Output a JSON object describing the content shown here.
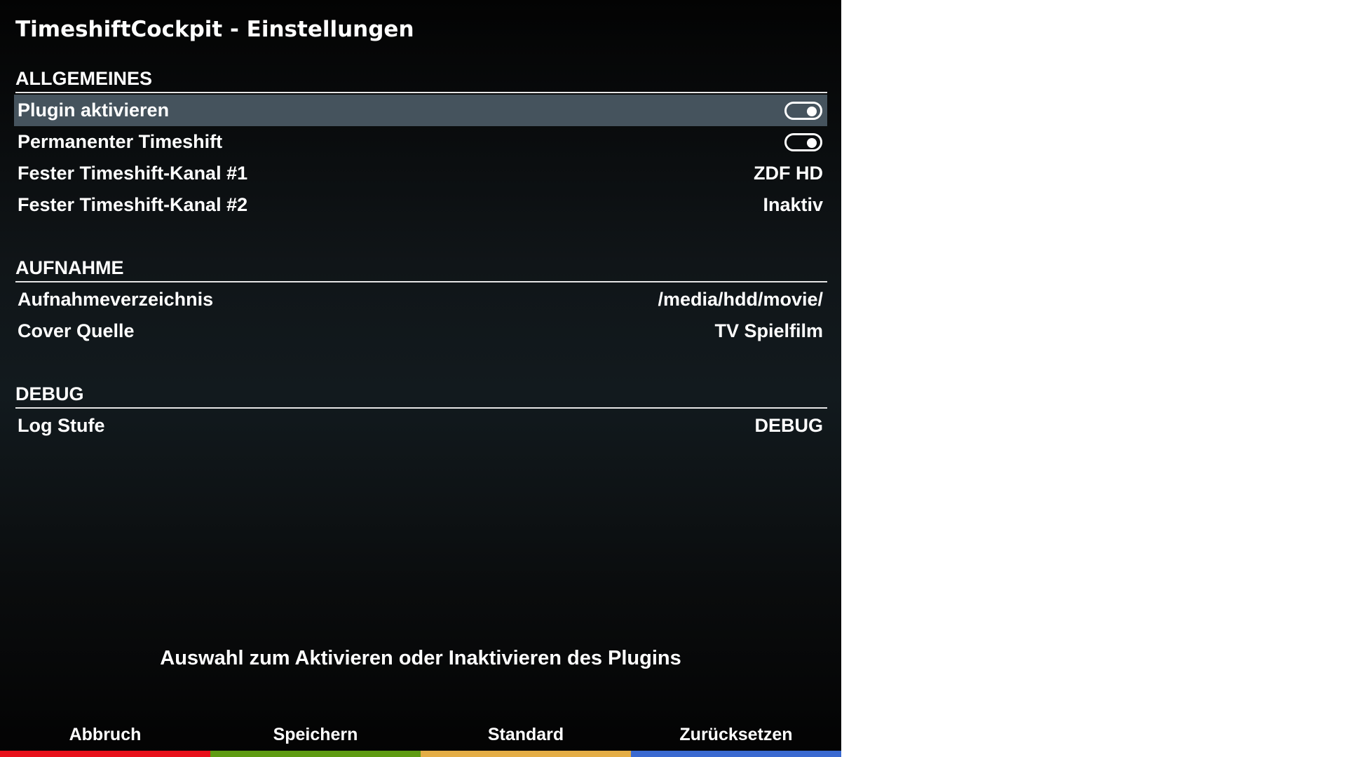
{
  "title": "TimeshiftCockpit - Einstellungen",
  "sections": [
    {
      "header": "ALLGEMEINES"
    },
    {
      "header": "AUFNAHME"
    },
    {
      "header": "DEBUG"
    }
  ],
  "settings": {
    "plugin_active": {
      "label": "Plugin aktivieren",
      "value": "on"
    },
    "permanent_timeshift": {
      "label": "Permanenter Timeshift",
      "value": "on"
    },
    "channel1": {
      "label": "Fester Timeshift-Kanal #1",
      "value": "ZDF HD"
    },
    "channel2": {
      "label": "Fester Timeshift-Kanal #2",
      "value": "Inaktiv"
    },
    "record_dir": {
      "label": "Aufnahmeverzeichnis",
      "value": "/media/hdd/movie/"
    },
    "cover_source": {
      "label": "Cover Quelle",
      "value": "TV Spielfilm"
    },
    "log_level": {
      "label": "Log Stufe",
      "value": "DEBUG"
    }
  },
  "help_text": "Auswahl zum Aktivieren oder Inaktivieren des Plugins",
  "buttons": {
    "red": {
      "label": "Abbruch",
      "color": "#e8101a"
    },
    "green": {
      "label": "Speichern",
      "color": "#5e9b12"
    },
    "yellow": {
      "label": "Standard",
      "color": "#e4ad45"
    },
    "blue": {
      "label": "Zurücksetzen",
      "color": "#3a69d0"
    }
  },
  "selected_item": "Plugin aktivieren"
}
